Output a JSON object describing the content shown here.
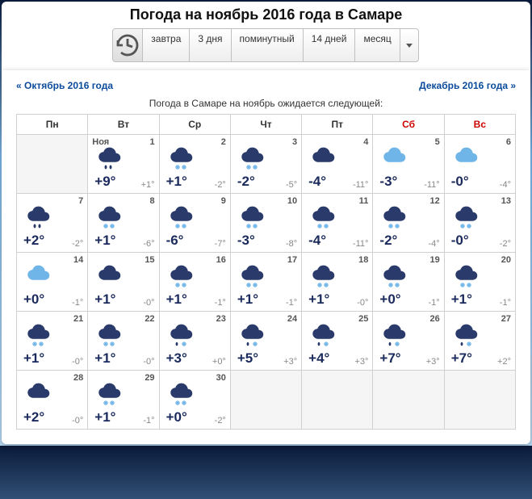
{
  "title": "Погода на ноябрь 2016 года в Самаре",
  "tabs": {
    "tomorrow": "завтра",
    "three_days": "3 дня",
    "minute": "поминутный",
    "fourteen": "14 дней",
    "month": "месяц"
  },
  "nav": {
    "prev": "« Октябрь 2016 года",
    "next": "Декабрь 2016 года »"
  },
  "subtitle": "Погода в Самаре на ноябрь ожидается следующей:",
  "weekdays": [
    "Пн",
    "Вт",
    "Ср",
    "Чт",
    "Пт",
    "Сб",
    "Вс"
  ],
  "month_label": "Ноя",
  "days": [
    {
      "d": 1,
      "icon": "cloud-rain-dark",
      "hi": "+9°",
      "lo": "+1°",
      "month_label": true
    },
    {
      "d": 2,
      "icon": "cloud-snow-dark",
      "hi": "+1°",
      "lo": "-2°"
    },
    {
      "d": 3,
      "icon": "cloud-snow-dark",
      "hi": "-2°",
      "lo": "-5°"
    },
    {
      "d": 4,
      "icon": "cloud-dark",
      "hi": "-4°",
      "lo": "-11°"
    },
    {
      "d": 5,
      "icon": "cloud-light",
      "hi": "-3°",
      "lo": "-11°"
    },
    {
      "d": 6,
      "icon": "cloud-light",
      "hi": "-0°",
      "lo": "-4°"
    },
    {
      "d": 7,
      "icon": "cloud-rain-dark",
      "hi": "+2°",
      "lo": "-2°"
    },
    {
      "d": 8,
      "icon": "cloud-snow-dark",
      "hi": "+1°",
      "lo": "-6°"
    },
    {
      "d": 9,
      "icon": "cloud-snow-dark",
      "hi": "-6°",
      "lo": "-7°"
    },
    {
      "d": 10,
      "icon": "cloud-snow-dark",
      "hi": "-3°",
      "lo": "-8°"
    },
    {
      "d": 11,
      "icon": "cloud-snow-dark",
      "hi": "-4°",
      "lo": "-11°"
    },
    {
      "d": 12,
      "icon": "cloud-snow-dark",
      "hi": "-2°",
      "lo": "-4°"
    },
    {
      "d": 13,
      "icon": "cloud-snow-dark",
      "hi": "-0°",
      "lo": "-2°"
    },
    {
      "d": 14,
      "icon": "cloud-light",
      "hi": "+0°",
      "lo": "-1°"
    },
    {
      "d": 15,
      "icon": "cloud-dark",
      "hi": "+1°",
      "lo": "-0°"
    },
    {
      "d": 16,
      "icon": "cloud-snow-dark",
      "hi": "+1°",
      "lo": "-1°"
    },
    {
      "d": 17,
      "icon": "cloud-snow-dark",
      "hi": "+1°",
      "lo": "-1°"
    },
    {
      "d": 18,
      "icon": "cloud-snow-dark",
      "hi": "+1°",
      "lo": "-0°"
    },
    {
      "d": 19,
      "icon": "cloud-snow-dark",
      "hi": "+0°",
      "lo": "-1°"
    },
    {
      "d": 20,
      "icon": "cloud-snow-dark",
      "hi": "+1°",
      "lo": "-1°"
    },
    {
      "d": 21,
      "icon": "cloud-snow-dark",
      "hi": "+1°",
      "lo": "-0°"
    },
    {
      "d": 22,
      "icon": "cloud-snow-dark",
      "hi": "+1°",
      "lo": "-0°"
    },
    {
      "d": 23,
      "icon": "cloud-rain-snow",
      "hi": "+3°",
      "lo": "+0°"
    },
    {
      "d": 24,
      "icon": "cloud-rain-snow",
      "hi": "+5°",
      "lo": "+3°"
    },
    {
      "d": 25,
      "icon": "cloud-rain-snow",
      "hi": "+4°",
      "lo": "+3°"
    },
    {
      "d": 26,
      "icon": "cloud-rain-snow",
      "hi": "+7°",
      "lo": "+3°"
    },
    {
      "d": 27,
      "icon": "cloud-rain-snow",
      "hi": "+7°",
      "lo": "+2°"
    },
    {
      "d": 28,
      "icon": "cloud-dark",
      "hi": "+2°",
      "lo": "-0°"
    },
    {
      "d": 29,
      "icon": "cloud-snow-dark",
      "hi": "+1°",
      "lo": "-1°"
    },
    {
      "d": 30,
      "icon": "cloud-snow-dark",
      "hi": "+0°",
      "lo": "-2°"
    }
  ],
  "lead_blanks": 1,
  "trail_blanks": 4
}
